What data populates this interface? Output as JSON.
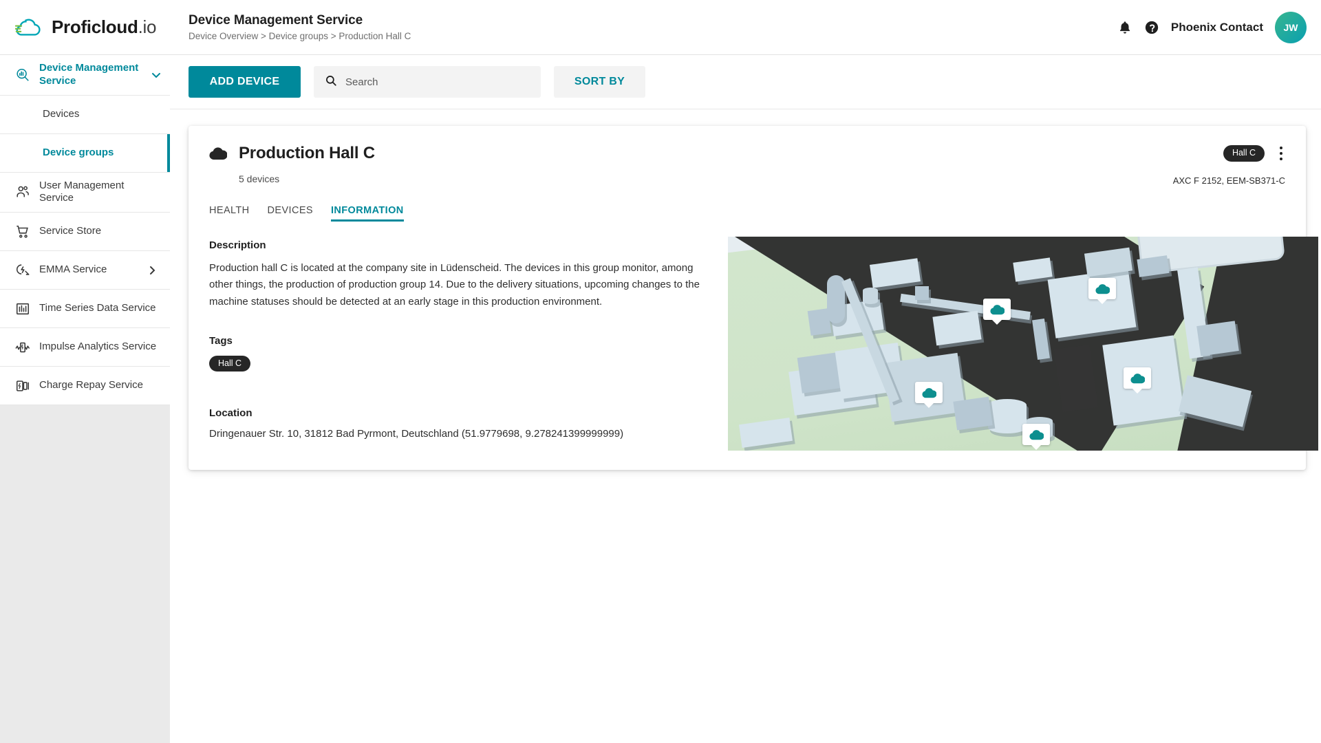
{
  "brand": {
    "name": "Proficloud",
    "suffix": ".io",
    "logo_icon": "cloud-speed-logo"
  },
  "sidebar": {
    "items": [
      {
        "label": "Device Management Service",
        "icon": "device-management-icon",
        "active": true,
        "expandable": true,
        "chevron": "chevron-down-icon"
      },
      {
        "label": "Devices",
        "icon": "",
        "sub": true,
        "active": false
      },
      {
        "label": "Device groups",
        "icon": "",
        "sub": true,
        "active": true
      },
      {
        "label": "User Management Service",
        "icon": "users-icon",
        "active": false
      },
      {
        "label": "Service Store",
        "icon": "shopping-cart-icon",
        "active": false
      },
      {
        "label": "EMMA Service",
        "icon": "emma-icon",
        "active": false,
        "chevron": "chevron-right-icon"
      },
      {
        "label": "Time Series Data Service",
        "icon": "bar-chart-icon",
        "active": false
      },
      {
        "label": "Impulse Analytics Service",
        "icon": "impulse-icon",
        "active": false
      },
      {
        "label": "Charge Repay Service",
        "icon": "battery-icon",
        "active": false
      }
    ]
  },
  "header": {
    "title": "Device Management Service",
    "breadcrumb": "Device Overview > Device groups > Production Hall C",
    "bell_icon": "notification-bell-icon",
    "help_icon": "help-circle-icon",
    "org": "Phoenix Contact",
    "avatar_initials": "JW"
  },
  "toolbar": {
    "add_device_label": "ADD DEVICE",
    "search_placeholder": "Search",
    "search_value": "",
    "search_icon": "search-icon",
    "sort_by_label": "SORT BY"
  },
  "card": {
    "cloud_icon": "cloud-icon",
    "title": "Production Hall C",
    "device_count": "5 devices",
    "badge": "Hall C",
    "kebab_icon": "more-vertical-icon",
    "models": "AXC F 2152, EEM-SB371-C",
    "tabs": [
      {
        "label": "HEALTH",
        "active": false
      },
      {
        "label": "DEVICES",
        "active": false
      },
      {
        "label": "INFORMATION",
        "active": true
      }
    ],
    "description_heading": "Description",
    "description": "Production hall C is located at the company site in Lüdenscheid. The devices in this group monitor, among other things, the production of production group 14. Due to the delivery situations, upcoming changes to the machine statuses should be detected at an early stage in this production environment.",
    "tags_heading": "Tags",
    "tags": [
      "Hall C"
    ],
    "location_heading": "Location",
    "location": "Dringenauer Str. 10, 31812 Bad Pyrmont, Deutschland (51.9779698, 9.278241399999999)",
    "map": {
      "alt": "3D isometric industrial site render",
      "pin_icon": "cloud-map-pin-icon",
      "pin_count": 5
    }
  },
  "colors": {
    "accent": "#00899b",
    "primary_button": "#00899b",
    "badge_bg": "#262626",
    "sidebar_bg": "#eaeaea",
    "avatar_gradient_start": "#37b58f",
    "avatar_gradient_end": "#0aa0b0",
    "map_ground": "#d0e5ca",
    "map_road": "#333433"
  }
}
